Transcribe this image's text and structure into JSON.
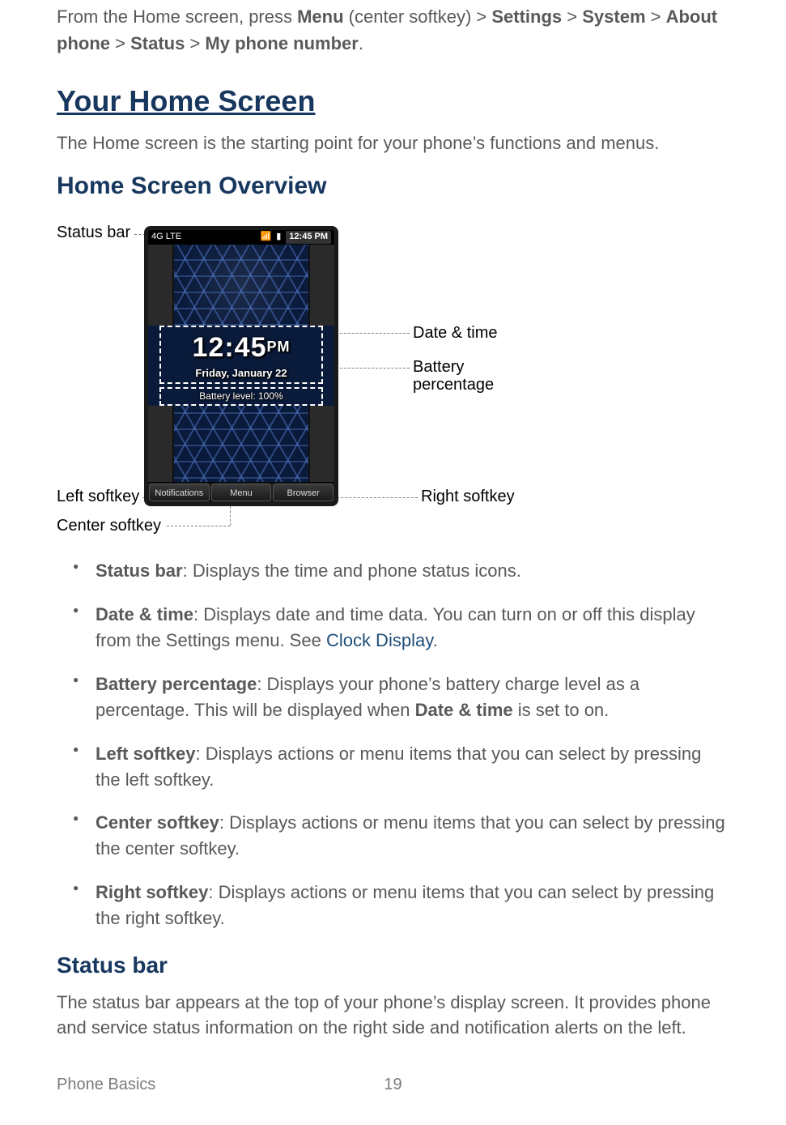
{
  "intro": {
    "prefix": "From the Home screen, press ",
    "menu": "Menu",
    "center_softkey": " (center softkey) > ",
    "settings": "Settings",
    "gt1": " > ",
    "system": "System",
    "gt2": " > ",
    "about_phone": "About phone",
    "gt3": " > ",
    "status": "Status",
    "gt4": " > ",
    "my_phone_number": "My phone number",
    "period": "."
  },
  "h1_your_home_screen": "Your Home Screen",
  "p_home_intro": "The Home screen is the starting point for your phone’s functions and menus.",
  "h2_overview": "Home Screen Overview",
  "diagram": {
    "annot_status_bar": "Status bar",
    "annot_date_time": "Date & time",
    "annot_battery_pct": "Battery",
    "annot_battery_pct_line2": "percentage",
    "annot_left_softkey": "Left softkey",
    "annot_center_softkey": "Center softkey",
    "annot_right_softkey": "Right softkey",
    "sb_lte": "4G LTE",
    "sb_time": "12:45 PM",
    "clock_time": "12:45",
    "clock_ampm": "PM",
    "clock_date": "Friday, January 22",
    "battery_level": "Battery level: 100%",
    "sk_left": "Notifications",
    "sk_center": "Menu",
    "sk_right": "Browser"
  },
  "defs": [
    {
      "term": "Status bar",
      "desc": ": Displays the time and phone status icons."
    },
    {
      "term": "Date & time",
      "desc_pre": ": Displays date and time data. You can turn on or off this display from the Settings menu. See ",
      "link": "Clock Display",
      "desc_post": "."
    },
    {
      "term": "Battery percentage",
      "desc_pre": ": Displays your phone’s battery charge level as a percentage. This will be displayed when ",
      "bold_inline": "Date & time",
      "desc_post": " is set to on."
    },
    {
      "term": "Left softkey",
      "desc": ": Displays actions or menu items that you can select by pressing the left softkey."
    },
    {
      "term": "Center softkey",
      "desc": ": Displays actions or menu items that you can select by pressing the center softkey."
    },
    {
      "term": "Right softkey",
      "desc": ": Displays actions or menu items that you can select by pressing the right softkey."
    }
  ],
  "h3_status_bar": "Status bar",
  "p_status_bar": "The status bar appears at the top of your phone’s display screen. It provides phone and service status information on the right side and notification alerts on the left.",
  "footer": {
    "section": "Phone Basics",
    "page": "19"
  }
}
